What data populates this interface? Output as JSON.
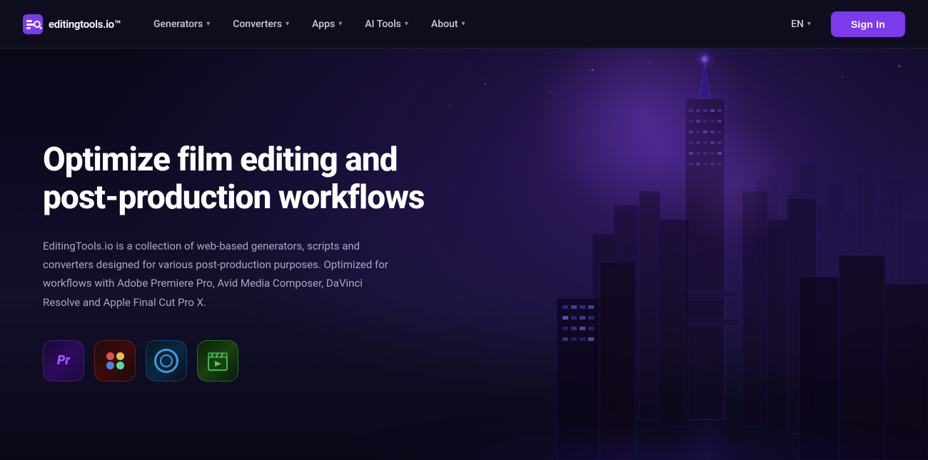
{
  "nav": {
    "logo_text": "editingtools.io™",
    "items": [
      {
        "label": "Generators",
        "has_dropdown": true
      },
      {
        "label": "Converters",
        "has_dropdown": true
      },
      {
        "label": "Apps",
        "has_dropdown": true
      },
      {
        "label": "AI Tools",
        "has_dropdown": true
      },
      {
        "label": "About",
        "has_dropdown": true
      }
    ],
    "lang": "EN",
    "sign_in": "Sign In"
  },
  "hero": {
    "title": "Optimize film editing and post-production workflows",
    "description": "EditingTools.io is a collection of web-based generators, scripts and converters designed for various post-production purposes. Optimized for workflows with Adobe Premiere Pro, Avid Media Composer, DaVinci Resolve and Apple Final Cut Pro X.",
    "app_icons": [
      {
        "id": "pr",
        "label": "Pr",
        "title": "Adobe Premiere Pro"
      },
      {
        "id": "davinci",
        "label": "DaVinci",
        "title": "DaVinci Resolve"
      },
      {
        "id": "avid",
        "label": "Avid",
        "title": "Avid Media Composer"
      },
      {
        "id": "fcpx",
        "label": "FCPX",
        "title": "Final Cut Pro X"
      }
    ]
  }
}
